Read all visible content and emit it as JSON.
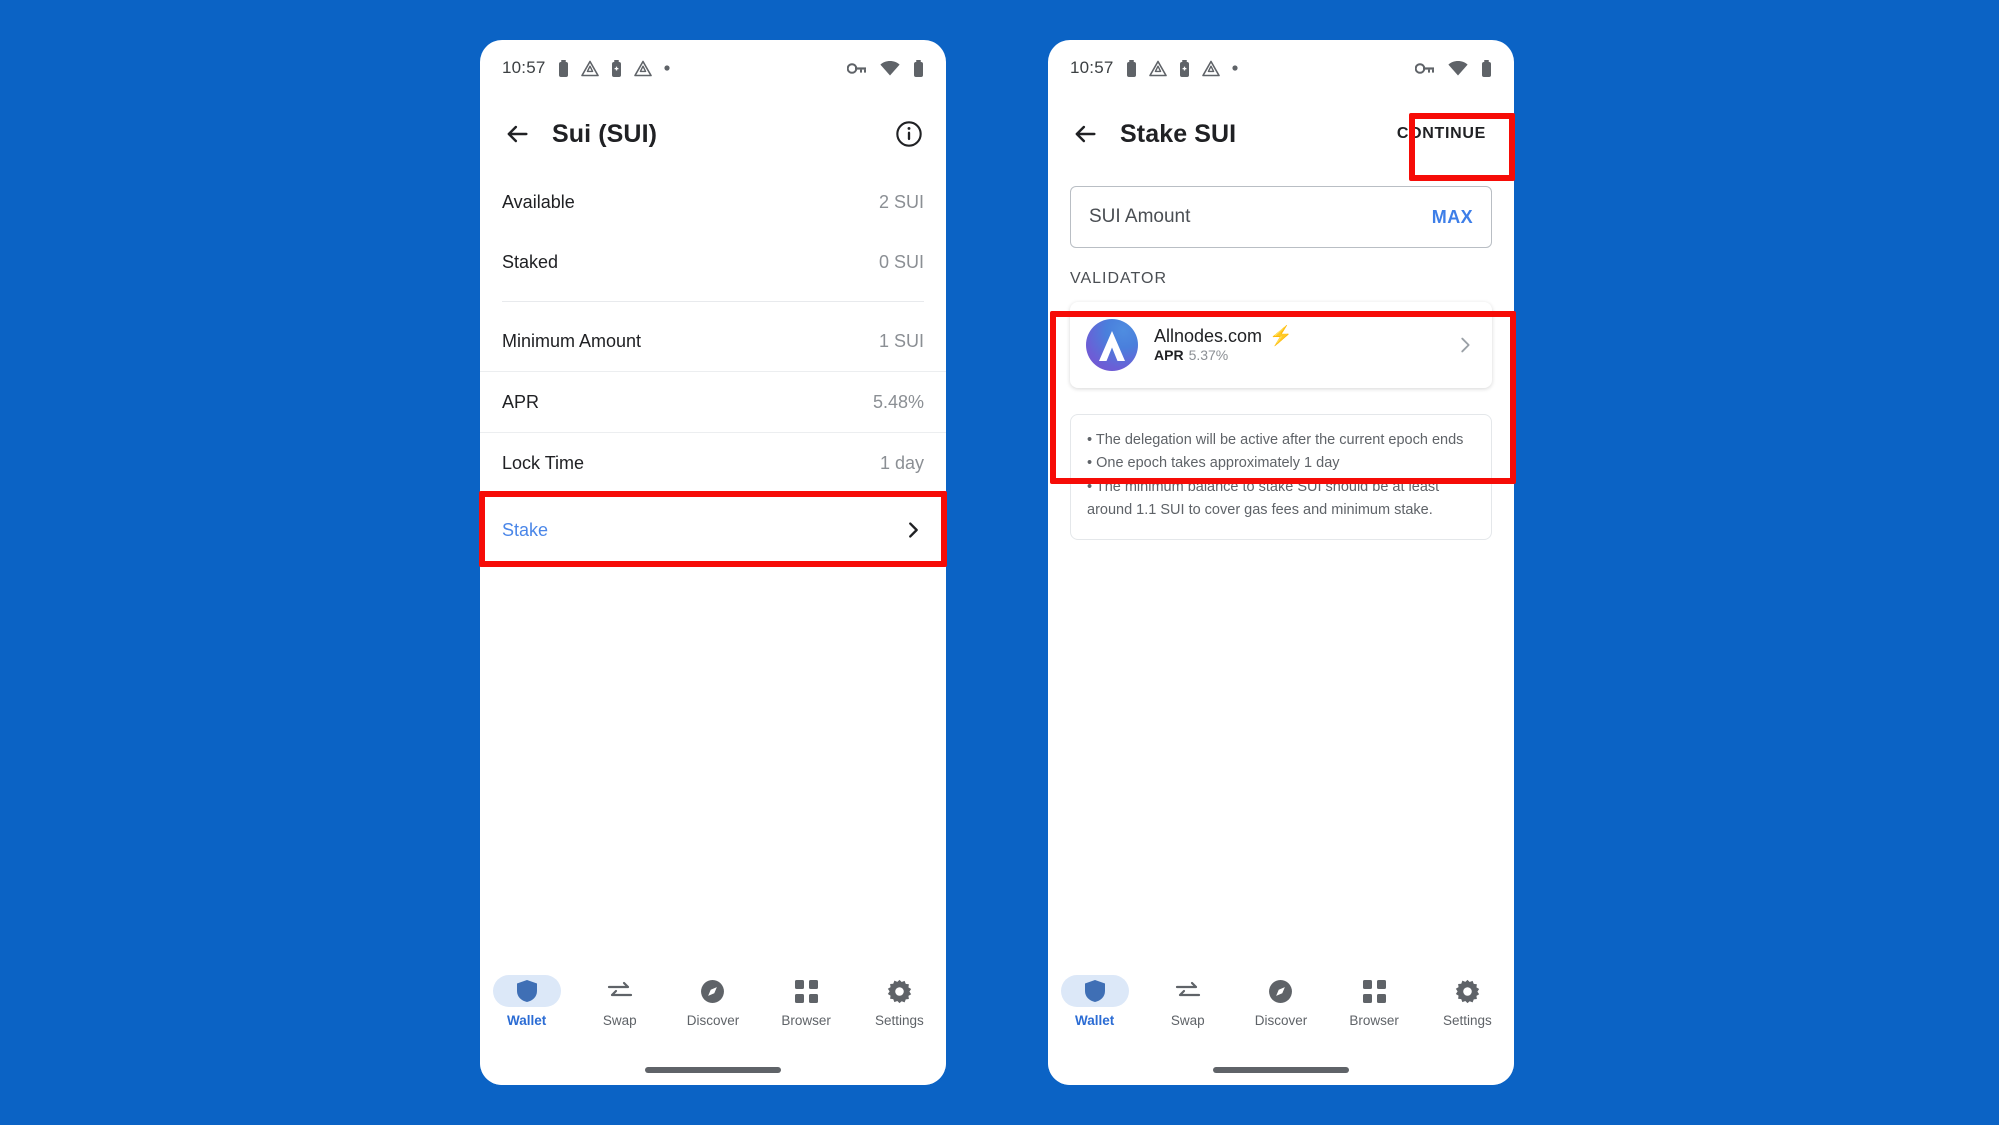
{
  "background_color": "#0b63c5",
  "annotation_color": "#f60c07",
  "accent_blue": "#3d7ee8",
  "status_bar": {
    "time": "10:57",
    "left_icons": [
      "battery-icon",
      "warning-triangle-icon",
      "battery-charging-icon",
      "warning-triangle-icon",
      "dot-icon"
    ],
    "right_icons": [
      "vpn-key-icon",
      "wifi-icon",
      "battery-icon"
    ]
  },
  "phone_left": {
    "appbar": {
      "back_label": "back-arrow-icon",
      "title": "Sui (SUI)",
      "info_label": "info-icon"
    },
    "rows_group_one": [
      {
        "label": "Available",
        "value": "2 SUI"
      },
      {
        "label": "Staked",
        "value": "0 SUI"
      }
    ],
    "rows_group_two": [
      {
        "label": "Minimum Amount",
        "value": "1 SUI"
      },
      {
        "label": "APR",
        "value": "5.48%"
      },
      {
        "label": "Lock Time",
        "value": "1 day"
      }
    ],
    "stake_row": {
      "label": "Stake"
    }
  },
  "phone_right": {
    "appbar": {
      "back_label": "back-arrow-icon",
      "title": "Stake SUI",
      "continue_label": "CONTINUE"
    },
    "amount_field": {
      "placeholder": "SUI Amount",
      "value": "",
      "max_label": "MAX"
    },
    "validator": {
      "section_title": "VALIDATOR",
      "name": "Allnodes.com",
      "badge": "bolt-icon",
      "apr_label": "APR",
      "apr_value": "5.37%"
    },
    "notes": [
      "• The delegation will be active after the current epoch ends",
      "• One epoch takes approximately 1 day",
      "• The minimum balance to stake SUI should be at least around 1.1 SUI to cover gas fees and minimum stake."
    ]
  },
  "bottom_nav": {
    "items": [
      {
        "label": "Wallet",
        "icon": "shield-icon",
        "active": true
      },
      {
        "label": "Swap",
        "icon": "swap-arrows-icon",
        "active": false
      },
      {
        "label": "Discover",
        "icon": "compass-icon",
        "active": false
      },
      {
        "label": "Browser",
        "icon": "grid-icon",
        "active": false
      },
      {
        "label": "Settings",
        "icon": "gear-icon",
        "active": false
      }
    ]
  }
}
